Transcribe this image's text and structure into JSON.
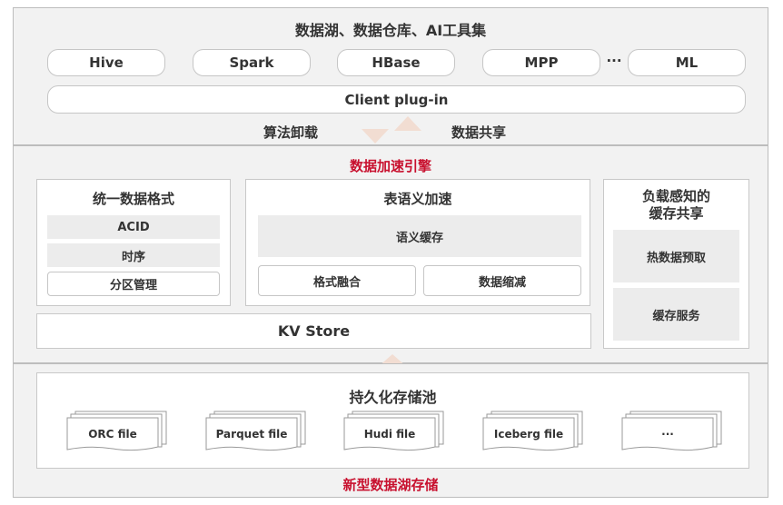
{
  "top": {
    "title": "数据湖、数据仓库、AI工具集",
    "tools": [
      "Hive",
      "Spark",
      "HBase",
      "MPP",
      "ML"
    ],
    "ellipsis": "···",
    "client": "Client plug-in"
  },
  "flow": {
    "down_label": "算法卸载",
    "up_label": "数据共享"
  },
  "engine": {
    "title": "数据加速引擎",
    "format": {
      "title": "统一数据格式",
      "items": [
        "ACID",
        "时序",
        "分区管理"
      ]
    },
    "semantic": {
      "title": "表语义加速",
      "cache": "语义缓存",
      "fusion": "格式融合",
      "reduce": "数据缩减"
    },
    "share": {
      "title": "负载感知的\n缓存共享",
      "items": [
        "热数据预取",
        "缓存服务"
      ]
    },
    "kv": "KV Store"
  },
  "storage": {
    "pool_title": "持久化存储池",
    "files": [
      "ORC file",
      "Parquet file",
      "Hudi file",
      "Iceberg file",
      "···"
    ],
    "title": "新型数据湖存储"
  }
}
